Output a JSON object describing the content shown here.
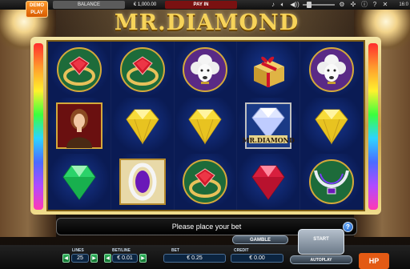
{
  "topbar": {
    "demo_label_1": "DEMO",
    "demo_label_2": "PLAY",
    "balance_label": "BALANCE",
    "balance_value": "€ 1,000.00",
    "payin_label": "PAY IN",
    "clock": "16:0"
  },
  "logo": {
    "text": "MR.DIAMOND"
  },
  "reels": {
    "rows": [
      [
        "ruby-ring",
        "ruby-ring",
        "white-poodle",
        "gold-gift-box",
        "white-poodle"
      ],
      [
        "lady-portrait",
        "yellow-diamond",
        "yellow-diamond",
        "mr-diamond-wild",
        "yellow-diamond"
      ],
      [
        "green-emerald",
        "sapphire-ring",
        "ruby-ring",
        "red-ruby-gem",
        "sapphire-necklace"
      ]
    ],
    "wild_label": "MR.DIAMOND"
  },
  "panel": {
    "message": "Please place your bet",
    "help_label": "?",
    "gamble_label": "GAMBLE",
    "start_label": "START",
    "autoplay_label": "AUTOPLAY"
  },
  "bet": {
    "lines_label": "LINES",
    "lines_value": "25",
    "betline_label": "BET/LINE",
    "betline_value": "€ 0.01",
    "bet_label": "BET",
    "bet_value": "€ 0.25",
    "credit_label": "CREDIT",
    "credit_value": "€ 0.00"
  },
  "brand": {
    "logo_text": "HP"
  },
  "colors": {
    "accent_orange": "#d85b00",
    "reel_bg": "#0c1a4a",
    "gold": "#f6d35a",
    "payin_red": "#7a1111"
  }
}
